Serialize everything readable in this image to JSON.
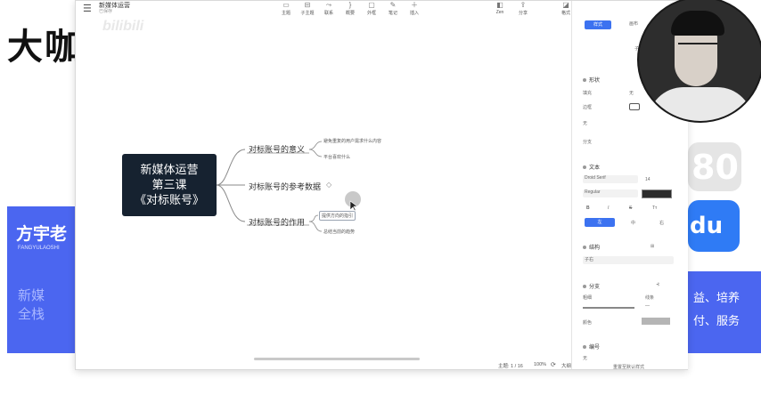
{
  "background": {
    "title_partial": "大咖",
    "card_name_partial": "方宇老",
    "card_sub": "FANGYULAOSHI",
    "card_desc_partial": [
      "新媒",
      "全栈"
    ],
    "right_card_text": [
      "益、培养",
      "付、服务"
    ]
  },
  "app": {
    "doc_title": "新媒体运营",
    "doc_subtitle": "已保存",
    "watermark": "bilibili",
    "toolbar_center": [
      {
        "icon": "style-icon",
        "label": "主题"
      },
      {
        "icon": "subtopic-icon",
        "label": "子主题"
      },
      {
        "icon": "link-icon",
        "label": "联系"
      },
      {
        "icon": "summary-icon",
        "label": "概要"
      },
      {
        "icon": "frame-icon",
        "label": "外框"
      },
      {
        "icon": "note-icon",
        "label": "笔记"
      },
      {
        "icon": "insert-icon",
        "label": "插入"
      }
    ],
    "toolbar_right": [
      {
        "icon": "zen-icon",
        "label": "Zen"
      },
      {
        "icon": "share-icon",
        "label": "分享"
      },
      {
        "icon": "format-icon",
        "label": "格式"
      }
    ]
  },
  "mindmap": {
    "root": [
      "新媒体运营",
      "第三课",
      "《对标账号》"
    ],
    "branches": [
      {
        "label": "对标账号的意义",
        "leaves": [
          "避免重复的用户需求什么内容",
          "平台喜欢什么"
        ]
      },
      {
        "label": "对标账号的参考数据",
        "leaves": []
      },
      {
        "label": "对标账号的作用",
        "leaves": [
          "提供方向的指引",
          "总结当前的趋势"
        ]
      }
    ],
    "collapse_marker": "◇"
  },
  "status_bar": {
    "topics": "主题: 1 / 16",
    "zoom": "100%",
    "zoom_icon": "zoom-icon",
    "full": "大纲"
  },
  "panel": {
    "tab_active": "样式",
    "tab_2": "画布",
    "sub_label": "子主题",
    "shape_section": "形状",
    "fill_label": "填充",
    "fill_value": "无",
    "border_label": "边框",
    "border_value": "无",
    "branch_label": "分支",
    "text_section": "文本",
    "font_name": "Droid Serif",
    "font_size": "14",
    "font_weight": "Regular",
    "bold": "B",
    "italic": "I",
    "strike": "S",
    "case": "Tт",
    "align_left": "左",
    "align_center": "中",
    "align_right": "右",
    "structure_section": "结构",
    "structure_value": "子右",
    "branch_section": "分支",
    "thickness_label": "粗细",
    "line_label": "线条",
    "color_label": "颜色",
    "numbering_section": "编号",
    "numbering_value": "无",
    "reset": "重置至默认样式"
  }
}
